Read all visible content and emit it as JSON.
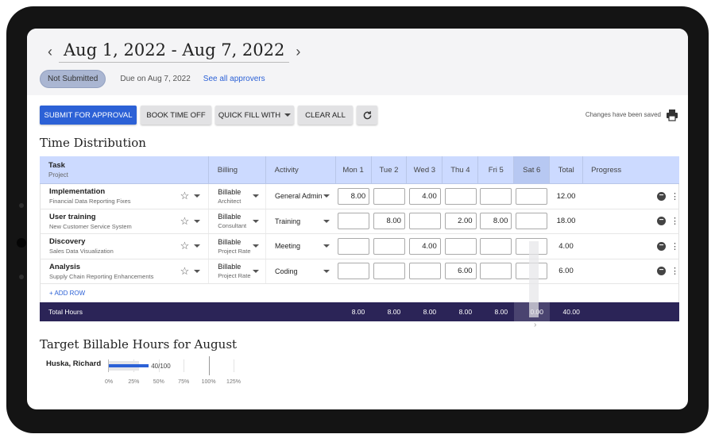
{
  "header": {
    "prev_icon": "chevron-left-icon",
    "next_icon": "chevron-right-icon",
    "date_range": "Aug 1, 2022 - Aug 7, 2022",
    "status": "Not Submitted",
    "due": "Due on Aug 7, 2022",
    "approvers_link": "See all approvers"
  },
  "toolbar": {
    "submit": "SUBMIT FOR APPROVAL",
    "book_time_off": "BOOK TIME OFF",
    "quick_fill": "QUICK FILL WITH",
    "clear_all": "CLEAR ALL",
    "refresh_icon": "refresh-icon",
    "saved_status": "Changes have been saved",
    "print_icon": "print-icon"
  },
  "colors": {
    "accent": "#2c61d6",
    "header_row": "#ccdaff",
    "footer_row": "#2b2457",
    "status_badge": "#aab6d2"
  },
  "time_distribution": {
    "title": "Time Distribution",
    "columns": {
      "task": "Task",
      "task_sub": "Project",
      "billing": "Billing",
      "activity": "Activity",
      "days": [
        "Mon 1",
        "Tue 2",
        "Wed 3",
        "Thu 4",
        "Fri 5",
        "Sat 6"
      ],
      "total": "Total",
      "progress": "Progress"
    },
    "rows": [
      {
        "task": "Implementation",
        "project": "Financial Data Reporting Fixes",
        "billing": "Billable",
        "rate": "Architect",
        "activity": "General Admin",
        "hours": [
          "8.00",
          "",
          "4.00",
          "",
          "",
          ""
        ],
        "total": "12.00"
      },
      {
        "task": "User training",
        "project": "New Customer Service System",
        "billing": "Billable",
        "rate": "Consultant",
        "activity": "Training",
        "hours": [
          "",
          "8.00",
          "",
          "2.00",
          "8.00",
          ""
        ],
        "total": "18.00"
      },
      {
        "task": "Discovery",
        "project": "Sales Data Visualization",
        "billing": "Billable",
        "rate": "Project Rate",
        "activity": "Meeting",
        "hours": [
          "",
          "",
          "4.00",
          "",
          "",
          ""
        ],
        "total": "4.00"
      },
      {
        "task": "Analysis",
        "project": "Supply Chain Reporting Enhancements",
        "billing": "Billable",
        "rate": "Project Rate",
        "activity": "Coding",
        "hours": [
          "",
          "",
          "",
          "6.00",
          "",
          ""
        ],
        "total": "6.00"
      }
    ],
    "add_row": "+ ADD ROW",
    "footer": {
      "label": "Total Hours",
      "day_totals": [
        "8.00",
        "8.00",
        "8.00",
        "8.00",
        "8.00",
        "0.00"
      ],
      "grand_total": "40.00"
    }
  },
  "target": {
    "title": "Target Billable Hours for August"
  },
  "chart_data": {
    "type": "bar",
    "orientation": "horizontal",
    "categories": [
      "Huska, Richard"
    ],
    "values": [
      40
    ],
    "target": 100,
    "data_labels": [
      "40/100"
    ],
    "x_ticks": [
      "0%",
      "25%",
      "50%",
      "75%",
      "100%",
      "125%"
    ],
    "xlim": [
      0,
      125
    ],
    "colors": {
      "fill": "#2c61d6",
      "background": "#e6e6e8"
    }
  }
}
